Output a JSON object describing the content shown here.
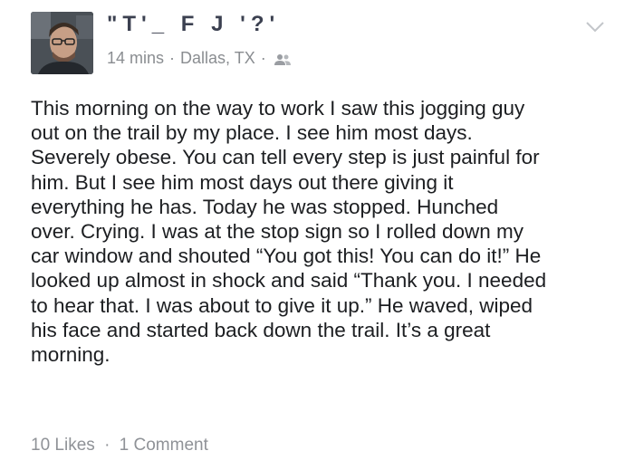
{
  "post": {
    "author_name": "\"T'_ F J '?'",
    "time": "14 mins",
    "location": "Dallas, TX",
    "separator": "·",
    "audience_icon": "friends-icon",
    "menu_icon": "chevron-down-icon",
    "body": "This morning on the way to work I saw this jogging guy\nout on the trail by my place. I see him most days.\nSeverely obese. You can tell every step is just painful for\nhim. But I see him most days out there giving it\neverything he has. Today he was stopped. Hunched\nover. Crying. I was at the stop sign so I rolled down my\ncar window and shouted “You got this! You can do it!” He\nlooked up almost in shock and said “Thank you. I needed\nto hear that. I was about to give it up.” He waved, wiped\nhis face and started back down the trail. It’s a great\nmorning.",
    "likes": "10 Likes",
    "comments": "1 Comment"
  }
}
